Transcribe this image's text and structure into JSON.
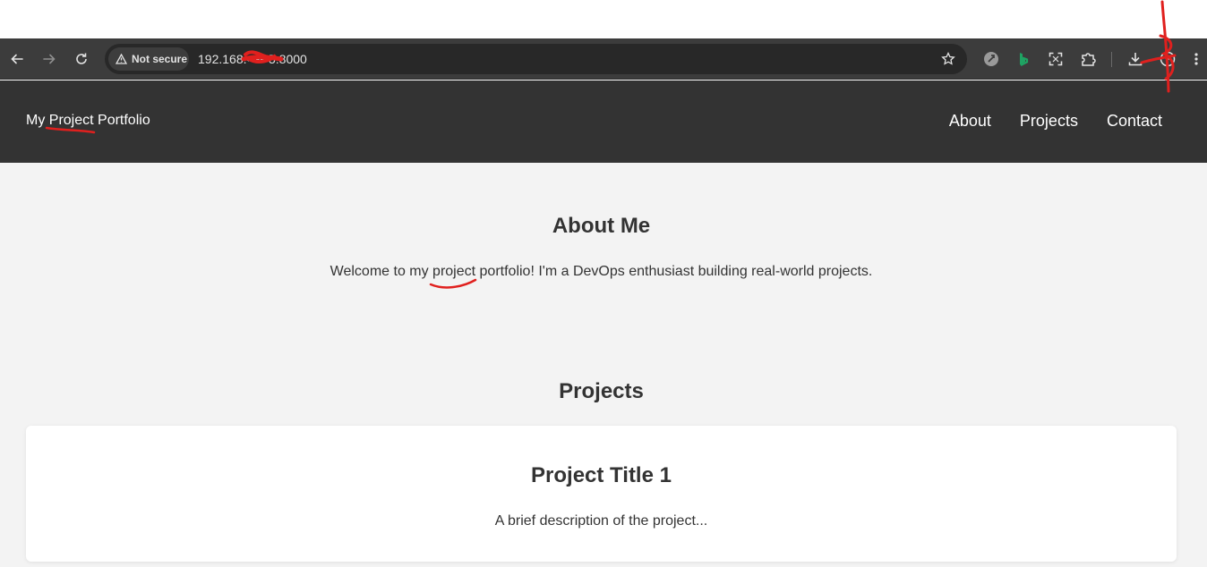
{
  "browser": {
    "security_label": "Not secure",
    "url": "192.168.•••••5:8000",
    "icons": [
      "back-icon",
      "forward-icon",
      "reload-icon",
      "warning-icon",
      "star-icon",
      "extension-icon",
      "bing-icon",
      "fullscreen-icon",
      "puzzle-icon",
      "download-icon",
      "profile-icon",
      "menu-icon"
    ],
    "colors": {
      "toolbar": "#3c3c3c",
      "omnibox": "#282828",
      "bing_green": "#1fa463"
    }
  },
  "site": {
    "brand": "My Project Portfolio",
    "nav": [
      {
        "label": "About"
      },
      {
        "label": "Projects"
      },
      {
        "label": "Contact"
      }
    ],
    "colors": {
      "header": "#333333",
      "page_bg": "#f3f3f3",
      "annotation": "#e0201e"
    }
  },
  "about": {
    "title": "About Me",
    "text": "Welcome to my project portfolio! I'm a DevOps enthusiast building real-world projects."
  },
  "projects": {
    "title": "Projects",
    "items": [
      {
        "title": "Project Title 1",
        "description": "A brief description of the project..."
      }
    ]
  }
}
